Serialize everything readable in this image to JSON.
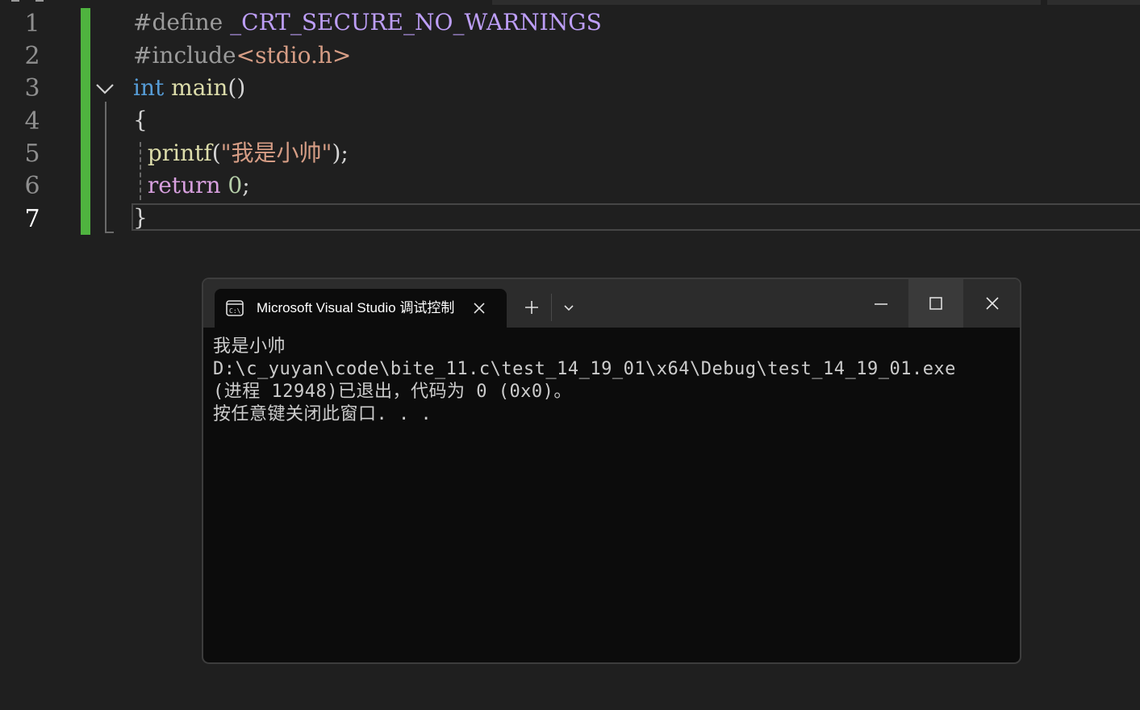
{
  "editor": {
    "line_numbers": [
      "1",
      "2",
      "3",
      "4",
      "5",
      "6",
      "7"
    ],
    "lines": {
      "l1": {
        "directive": "#define",
        "macro": "_CRT_SECURE_NO_WARNINGS"
      },
      "l2": {
        "directive": "#include",
        "header": "<stdio.h>"
      },
      "l3": {
        "type": "int",
        "func": "main",
        "parens": "()"
      },
      "l4": {
        "brace": "{"
      },
      "l5": {
        "func": "printf",
        "open": "(",
        "string": "\"我是小帅\"",
        "close": ");"
      },
      "l6": {
        "keyword": "return",
        "value": "0",
        "semi": ";"
      },
      "l7": {
        "brace": "}"
      }
    },
    "colors": {
      "change_bar": "#4fb33f",
      "keyword": "#569cd6",
      "function": "#dcdcaa",
      "string": "#d69d85",
      "macro": "#bd9ef7"
    }
  },
  "console": {
    "tab_title": "Microsoft Visual Studio 调试控制台",
    "tab_icon": "terminal-icon",
    "output": [
      "我是小帅",
      "D:\\c_yuyan\\code\\bite_11.c\\test_14_19_01\\x64\\Debug\\test_14_19_01.exe",
      "(进程 12948)已退出，代码为 0 (0x0)。",
      "按任意键关闭此窗口. . ."
    ]
  }
}
